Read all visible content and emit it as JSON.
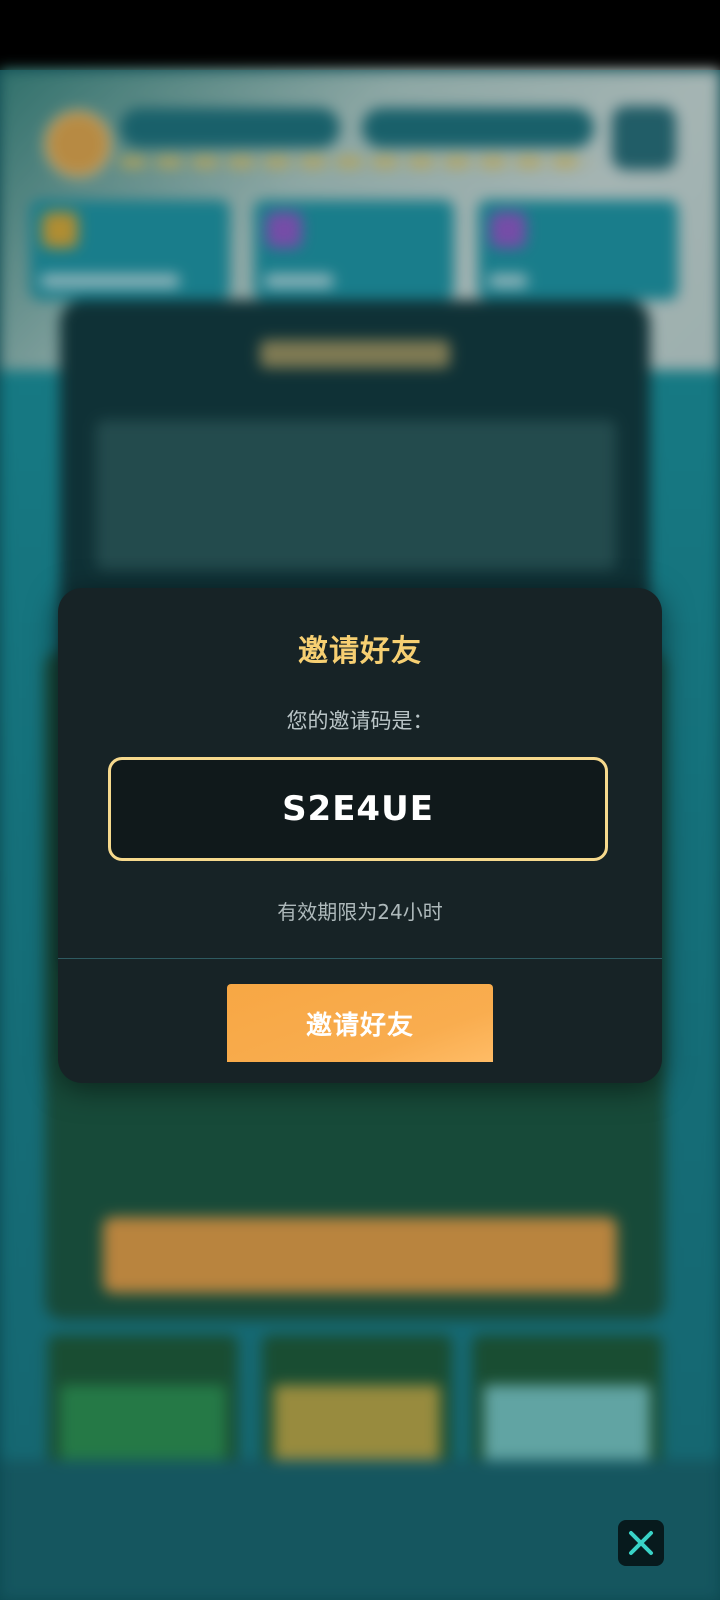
{
  "dialog": {
    "title": "邀请好友",
    "subtitle": "您的邀请码是：",
    "invite_code": "S2E4UE",
    "validity": "有效期限为24小时",
    "invite_button_label": "邀请好友"
  },
  "colors": {
    "accent": "#f6cf72",
    "button": "#f7a744",
    "dialog_bg": "#172326"
  },
  "icons": {
    "close": "close-icon"
  }
}
